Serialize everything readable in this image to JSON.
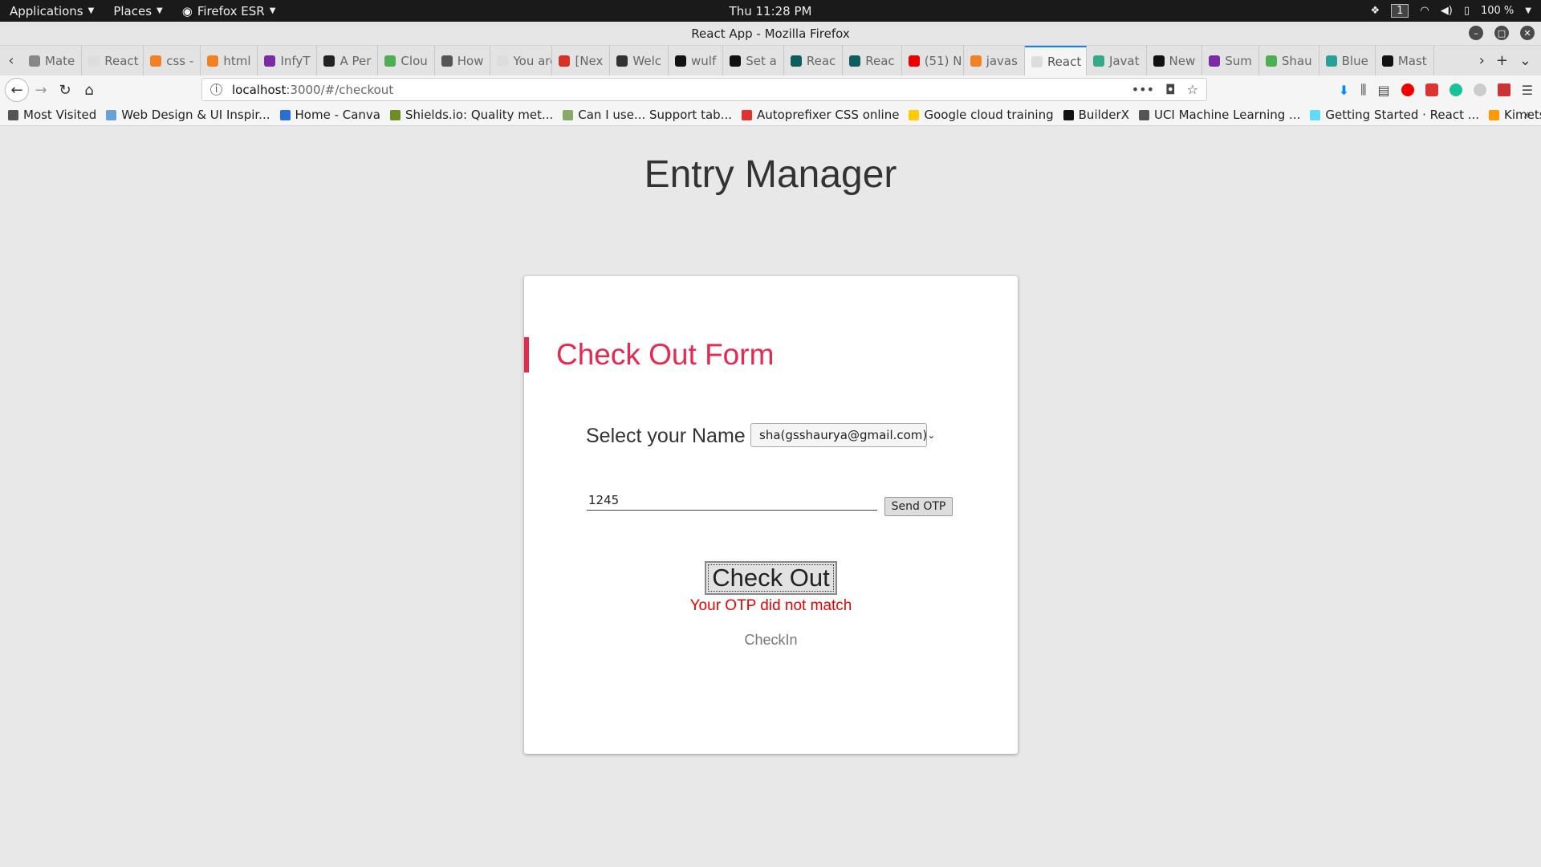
{
  "topbar": {
    "applications": "Applications",
    "places": "Places",
    "firefox": "Firefox ESR",
    "clock": "Thu 11:28 PM",
    "workspace": "1",
    "battery": "100 %"
  },
  "window": {
    "title": "React App - Mozilla Firefox"
  },
  "tabs": [
    {
      "label": "Mate",
      "color": "#888"
    },
    {
      "label": "React Ap",
      "color": "#ddd"
    },
    {
      "label": "css -",
      "color": "#f48024"
    },
    {
      "label": "html",
      "color": "#f48024"
    },
    {
      "label": "InfyT",
      "color": "#7b2aa8"
    },
    {
      "label": "A Per",
      "color": "#222"
    },
    {
      "label": "Clou",
      "color": "#4caf50"
    },
    {
      "label": "How",
      "color": "#555"
    },
    {
      "label": "You are",
      "color": "#ddd"
    },
    {
      "label": "[Nex",
      "color": "#d93025"
    },
    {
      "label": "Welc",
      "color": "#333"
    },
    {
      "label": "wulf",
      "color": "#111"
    },
    {
      "label": "Set a",
      "color": "#111"
    },
    {
      "label": "Reac",
      "color": "#0d5e5e"
    },
    {
      "label": "Reac",
      "color": "#0d5e5e"
    },
    {
      "label": "(51) N",
      "color": "#e00"
    },
    {
      "label": "javas",
      "color": "#f48024"
    },
    {
      "label": "React",
      "color": "#ddd",
      "active": true
    },
    {
      "label": "Javat",
      "color": "#3a8"
    },
    {
      "label": "New",
      "color": "#111"
    },
    {
      "label": "Sum",
      "color": "#7b2aa8"
    },
    {
      "label": "Shau",
      "color": "#4caf50"
    },
    {
      "label": "Blue",
      "color": "#2aa198"
    },
    {
      "label": "Mast",
      "color": "#111"
    }
  ],
  "navbar": {
    "url_host": "localhost",
    "url_path": ":3000/#/checkout"
  },
  "bookmarks": [
    {
      "label": "Most Visited",
      "color": "#555"
    },
    {
      "label": "Web Design & UI Inspir...",
      "color": "#6aa0d8"
    },
    {
      "label": "Home - Canva",
      "color": "#2a6fd6"
    },
    {
      "label": "Shields.io: Quality met...",
      "color": "#6b8e23"
    },
    {
      "label": "Can I use... Support tab...",
      "color": "#8a6"
    },
    {
      "label": "Autoprefixer CSS online",
      "color": "#d33"
    },
    {
      "label": "Google cloud training",
      "color": "#fc0"
    },
    {
      "label": "BuilderX",
      "color": "#111"
    },
    {
      "label": "UCI Machine Learning ...",
      "color": "#555"
    },
    {
      "label": "Getting Started · React ...",
      "color": "#61dafb"
    },
    {
      "label": "Kimetsu no Yaiba Episo...",
      "color": "#f90"
    }
  ],
  "page": {
    "app_title": "Entry Manager",
    "form_title": "Check Out Form",
    "name_label": "Select your Name",
    "name_selected": "sha(gsshaurya@gmail.com)",
    "otp_value": "1245",
    "send_otp_label": "Send OTP",
    "checkout_label": "Check Out",
    "error_message": "Your OTP did not match",
    "checkin_link": "CheckIn",
    "accent_color": "#e7294f",
    "error_color": "#e00000"
  }
}
